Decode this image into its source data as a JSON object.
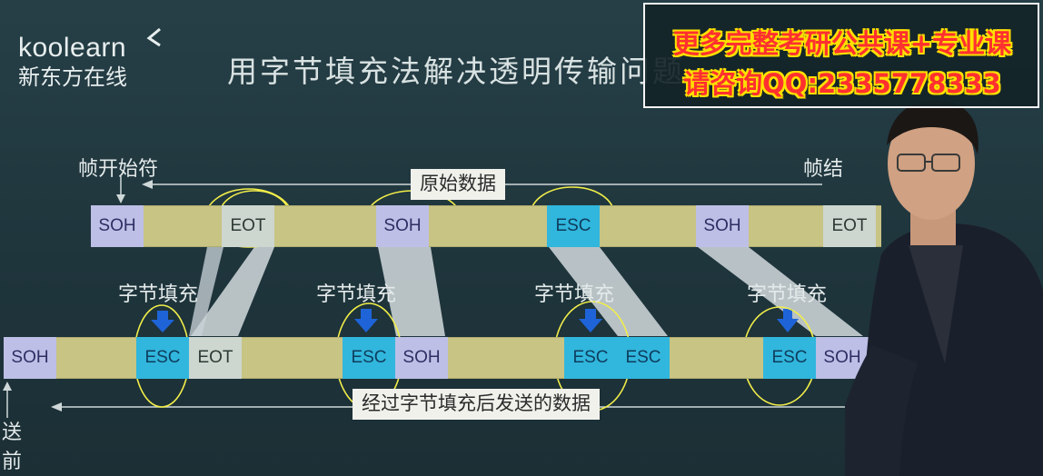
{
  "logo": {
    "en": "koolearn",
    "cn": "新东方在线"
  },
  "title": "用字节填充法解决透明传输问题",
  "ad": {
    "line1": "更多完整考研公共课+专业课",
    "line2": "请咨询QQ:2335778333",
    "color_text": "#ff3030",
    "color_outline": "#ffe000"
  },
  "labels": {
    "frame_start": "帧开始符",
    "frame_end": "帧结",
    "original_data": "原始数据",
    "stuffed_data": "经过字节填充后发送的数据",
    "send_before_1": "送",
    "send_before_2": "前"
  },
  "top_row": [
    {
      "name": "soh",
      "text": "SOH"
    },
    {
      "name": "eot",
      "text": "EOT"
    },
    {
      "name": "soh",
      "text": "SOH"
    },
    {
      "name": "esc",
      "text": "ESC"
    },
    {
      "name": "soh",
      "text": "SOH"
    },
    {
      "name": "eot",
      "text": "EOT"
    }
  ],
  "bottom_row": [
    {
      "name": "soh",
      "text": "SOH"
    },
    {
      "name": "esc",
      "text": "ESC"
    },
    {
      "name": "eot",
      "text": "EOT"
    },
    {
      "name": "esc",
      "text": "ESC"
    },
    {
      "name": "soh",
      "text": "SOH"
    },
    {
      "name": "esc",
      "text": "ESC"
    },
    {
      "name": "esc",
      "text": "ESC"
    },
    {
      "name": "esc",
      "text": "ESC"
    },
    {
      "name": "soh",
      "text": "SOH"
    }
  ],
  "stuffing_labels": [
    "字节填充",
    "字节填充",
    "字节填充",
    "字节填充"
  ],
  "colors": {
    "background": "#223a41",
    "bar": "#c8c484",
    "soh": "#bdbfe6",
    "eot": "#cdd6cf",
    "esc": "#31b6dd",
    "arrow": "#1e64d8",
    "annotation": "#f2ee4a"
  }
}
